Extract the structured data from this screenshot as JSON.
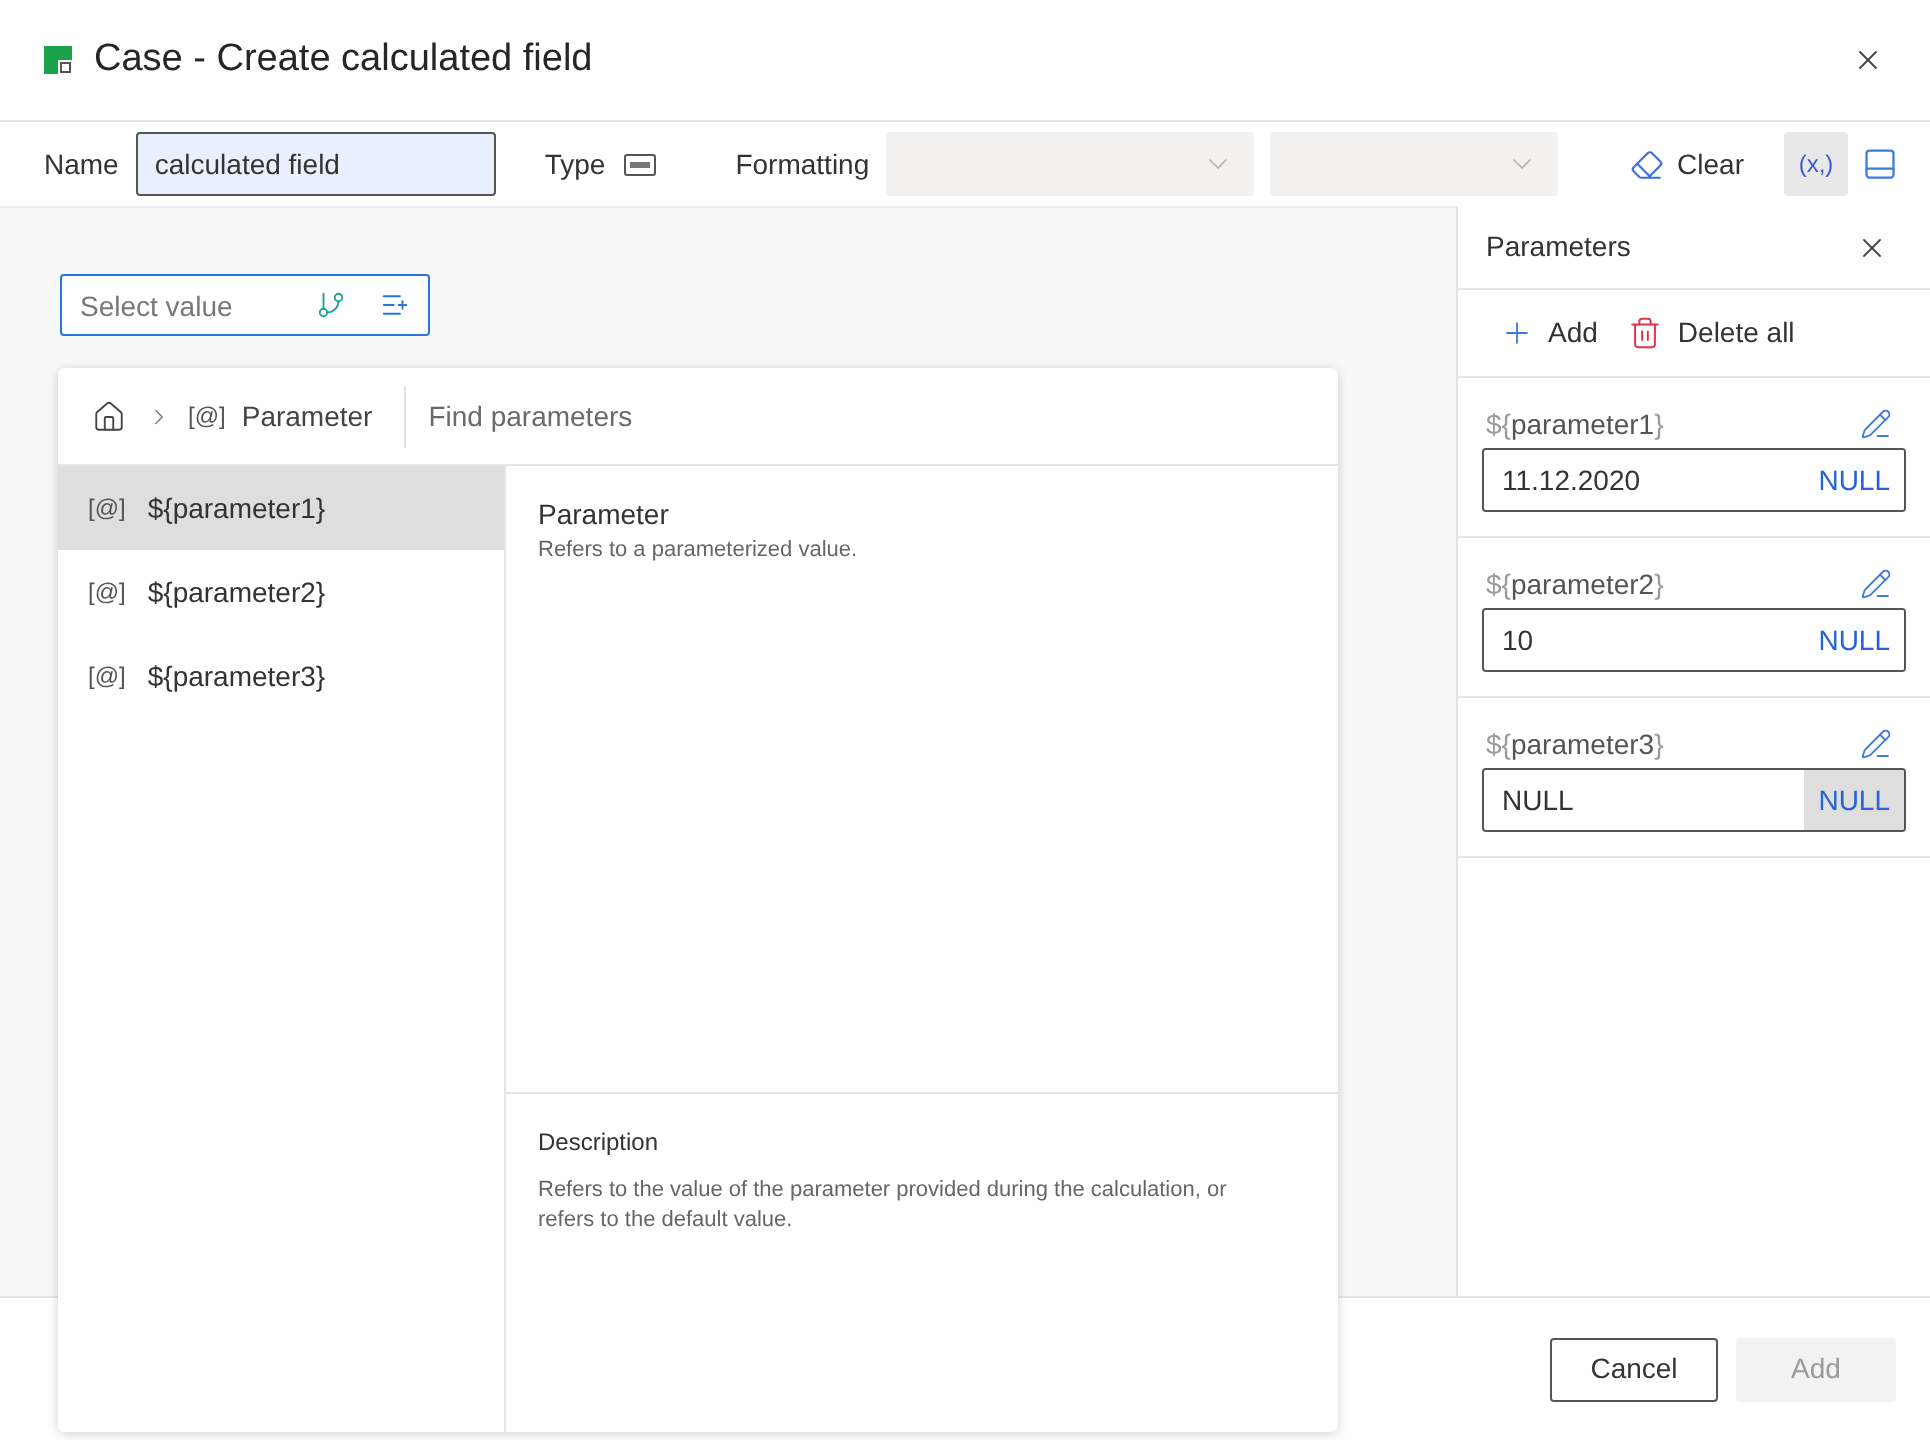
{
  "dialog": {
    "title": "Case - Create calculated field"
  },
  "toolbar": {
    "name_label": "Name",
    "name_value": "calculated field",
    "type_label": "Type",
    "formatting_label": "Formatting",
    "formatting_selects": [
      {
        "disabled": true
      },
      {
        "disabled": true
      }
    ],
    "clear_label": "Clear",
    "variables_button": {
      "label": "(x,)",
      "selected": true
    }
  },
  "select_value": {
    "placeholder": "Select value"
  },
  "popup": {
    "breadcrumb": {
      "tag": "[@]",
      "label": "Parameter"
    },
    "search": {
      "placeholder": "Find parameters"
    },
    "items": [
      {
        "tag": "[@]",
        "label": "${parameter1}",
        "selected": true
      },
      {
        "tag": "[@]",
        "label": "${parameter2}",
        "selected": false
      },
      {
        "tag": "[@]",
        "label": "${parameter3}",
        "selected": false
      }
    ],
    "detail": {
      "title": "Parameter",
      "text": "Refers to a parameterized value."
    },
    "description": {
      "title": "Description",
      "text": "Refers to the value of the parameter provided during the calculation, or refers to the default value."
    }
  },
  "parameters_panel": {
    "title": "Parameters",
    "add_label": "Add",
    "delete_all_label": "Delete all",
    "parameters": [
      {
        "open": "${",
        "name": "parameter1",
        "close": "}",
        "value": "11.12.2020",
        "null_label": "NULL",
        "null_selected": false
      },
      {
        "open": "${",
        "name": "parameter2",
        "close": "}",
        "value": "10",
        "null_label": "NULL",
        "null_selected": false
      },
      {
        "open": "${",
        "name": "parameter3",
        "close": "}",
        "value": "NULL",
        "null_label": "NULL",
        "null_selected": true
      }
    ]
  },
  "footer": {
    "buttons": [
      {
        "label": "Cancel",
        "disabled": false
      },
      {
        "label": "Add",
        "disabled": true
      }
    ]
  }
}
